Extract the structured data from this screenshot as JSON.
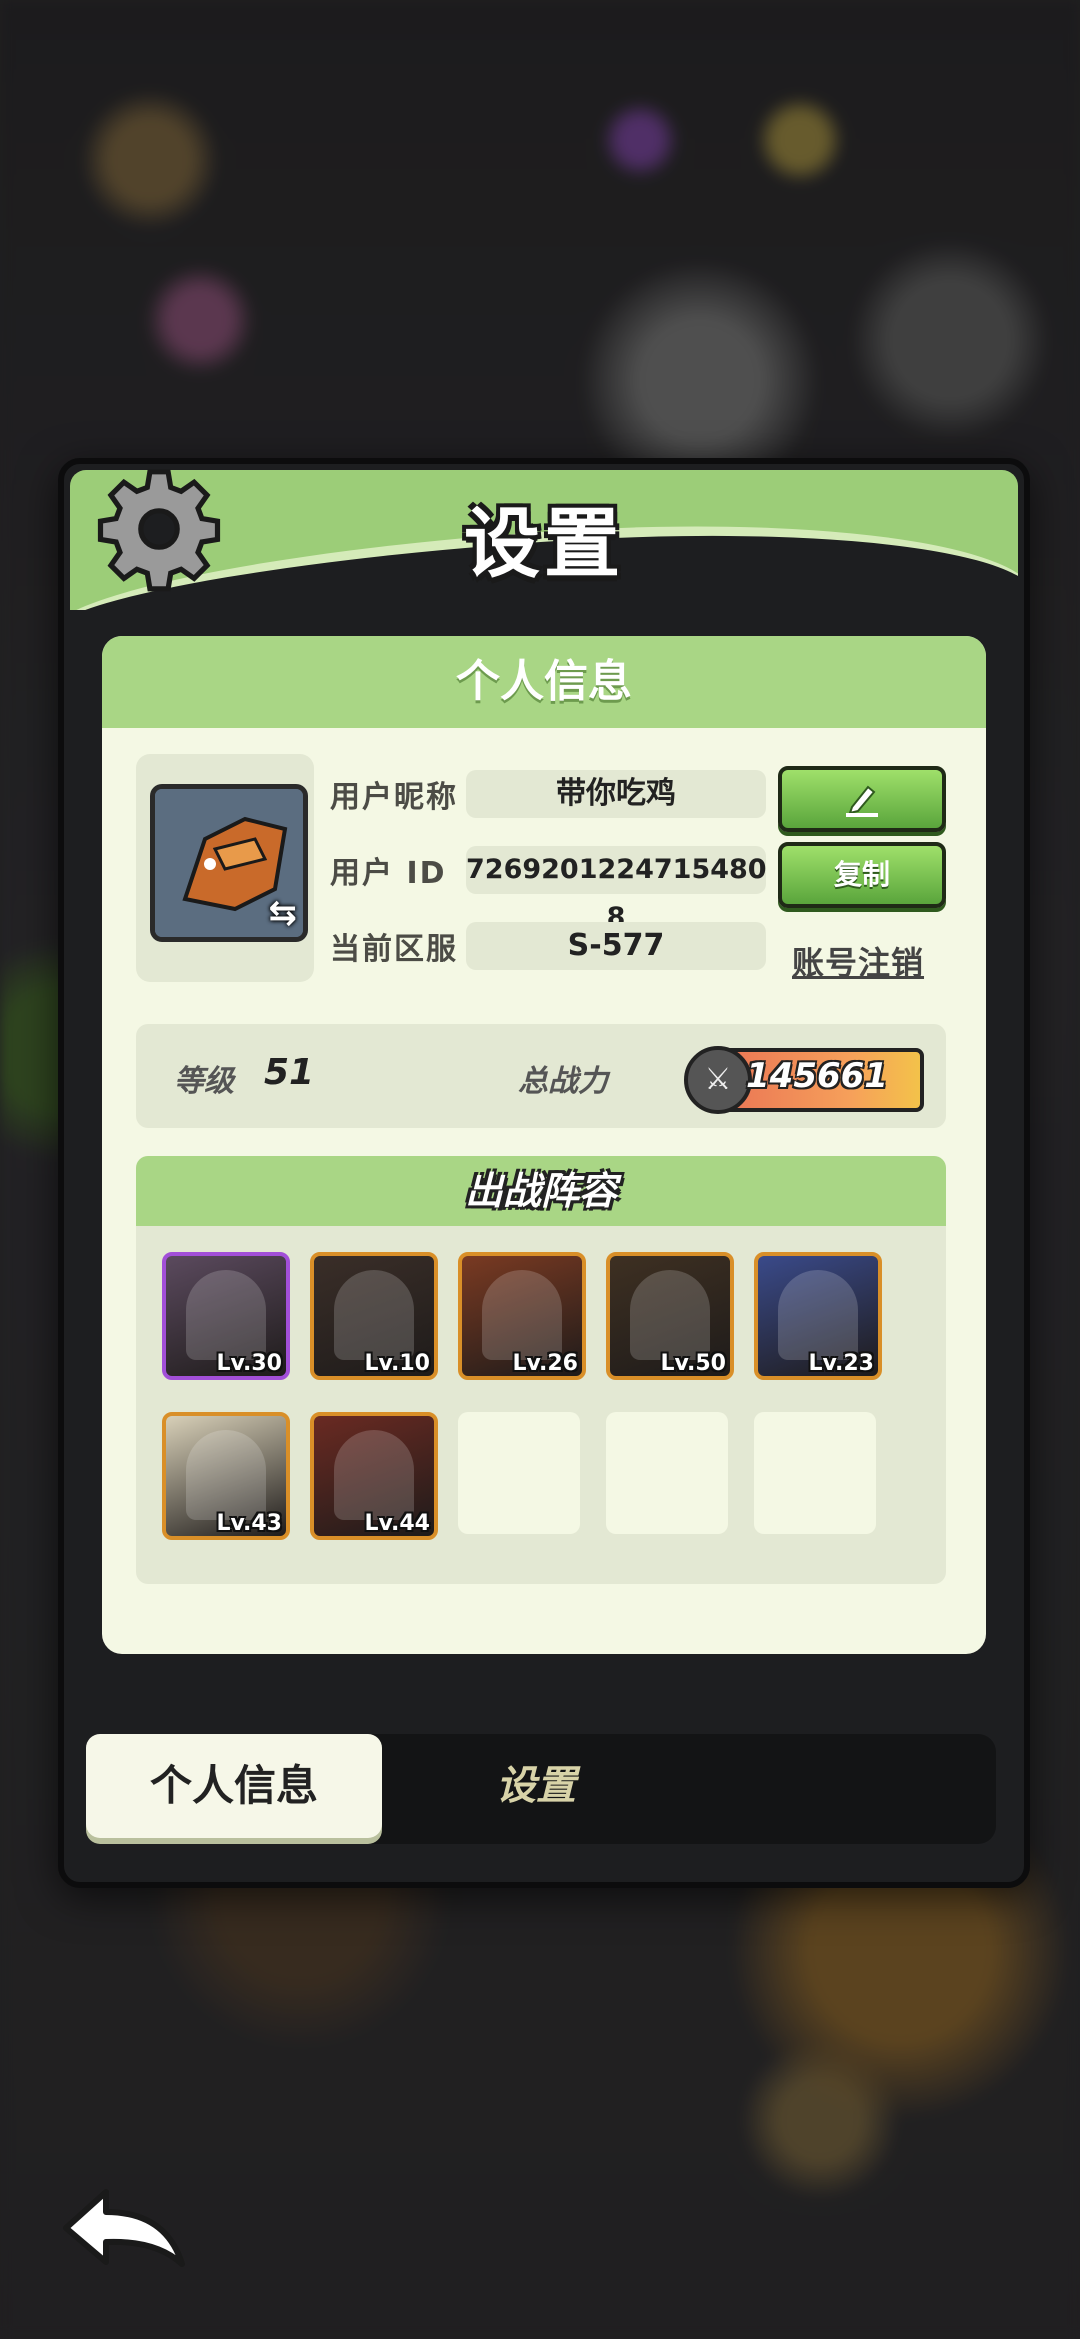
{
  "modal": {
    "title": "设置"
  },
  "personal_info": {
    "header": "个人信息",
    "nickname_label": "用户昵称",
    "nickname_value": "带你吃鸡",
    "id_label": "用户 ID",
    "id_value": "7269201224715480​8",
    "server_label": "当前区服",
    "server_value": "S-577",
    "copy_button": "复制",
    "account_cancel_link": "账号注销"
  },
  "stats": {
    "level_label": "等级",
    "level_value": "51",
    "power_label": "总战力",
    "power_value": "145661"
  },
  "lineup": {
    "header": "出战阵容",
    "heroes": [
      {
        "level": "Lv.30",
        "frame": "purple",
        "color": "#5b4a5e"
      },
      {
        "level": "Lv.10",
        "frame": "orange",
        "color": "#3a2e28"
      },
      {
        "level": "Lv.26",
        "frame": "orange",
        "color": "#7a3a22"
      },
      {
        "level": "Lv.50",
        "frame": "orange",
        "color": "#3e3022"
      },
      {
        "level": "Lv.23",
        "frame": "orange",
        "color": "#3a4a8a"
      },
      {
        "level": "Lv.43",
        "frame": "orange",
        "color": "#d8d0b8"
      },
      {
        "level": "Lv.44",
        "frame": "orange",
        "color": "#6a2a22"
      }
    ]
  },
  "tabs": {
    "personal": "个人信息",
    "settings": "设置"
  },
  "icons": {
    "settings": "gear-icon",
    "edit": "pencil-icon",
    "swap": "swap-icon",
    "power": "crossed-swords-icon",
    "back": "back-arrow-icon"
  },
  "colors": {
    "accent_green": "#9ccd78",
    "button_green": "#5aa53c",
    "panel_bg": "#f4f8e4"
  }
}
